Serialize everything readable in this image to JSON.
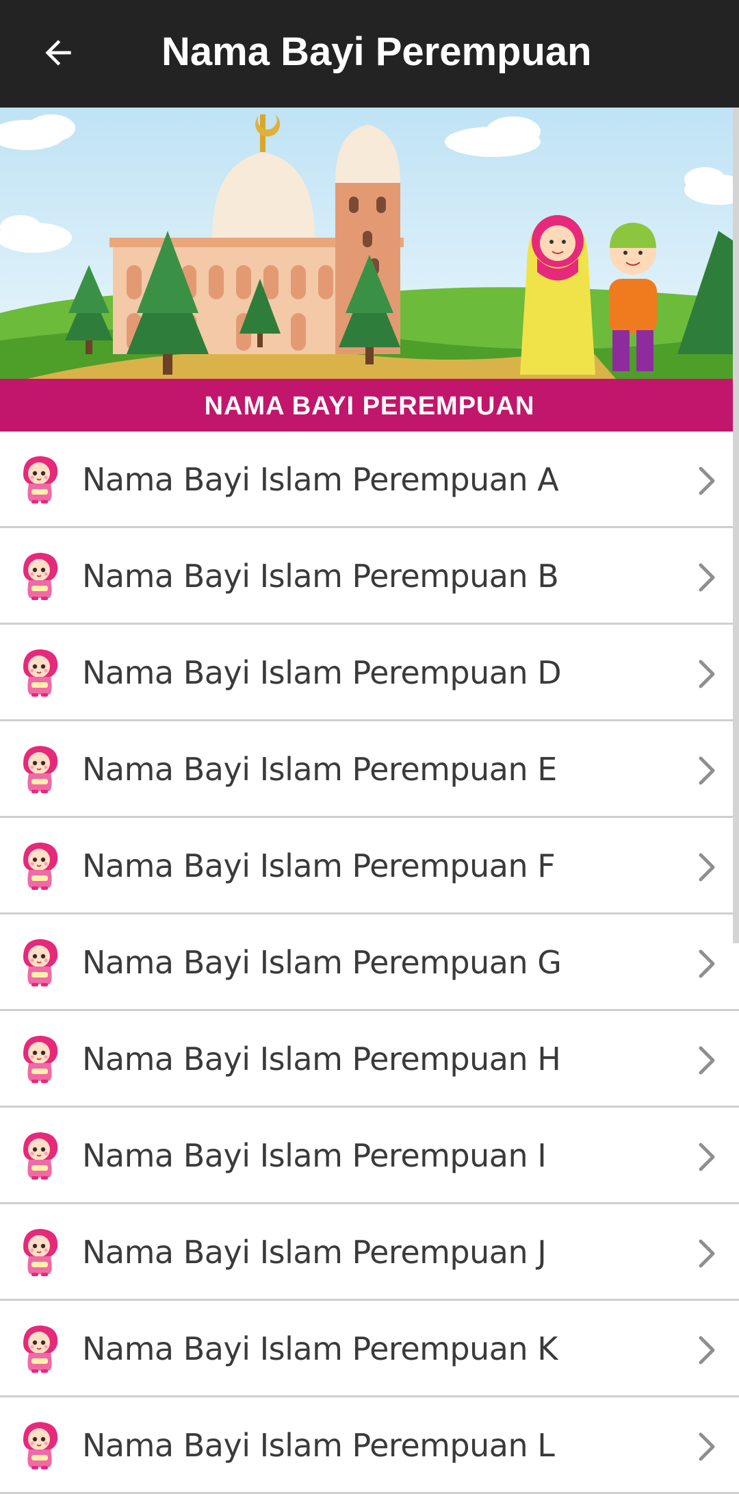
{
  "appbar": {
    "title": "Nama Bayi Perempuan"
  },
  "banner": {
    "label": "NAMA BAYI PEREMPUAN"
  },
  "list": {
    "items": [
      {
        "label": "Nama Bayi Islam Perempuan A"
      },
      {
        "label": "Nama Bayi Islam Perempuan B"
      },
      {
        "label": "Nama Bayi Islam Perempuan D"
      },
      {
        "label": "Nama Bayi Islam Perempuan E"
      },
      {
        "label": "Nama Bayi Islam Perempuan F"
      },
      {
        "label": "Nama Bayi Islam Perempuan G"
      },
      {
        "label": "Nama Bayi Islam Perempuan H"
      },
      {
        "label": "Nama Bayi Islam Perempuan I"
      },
      {
        "label": "Nama Bayi Islam Perempuan J"
      },
      {
        "label": "Nama Bayi Islam Perempuan K"
      },
      {
        "label": "Nama Bayi Islam Perempuan L"
      }
    ]
  },
  "colors": {
    "appbar": "#232323",
    "accent": "#c1166b",
    "divider": "#cfcfcf"
  },
  "icons": {
    "back": "arrow-left-icon",
    "row": "hijab-girl-icon",
    "chevron": "chevron-right-icon"
  }
}
